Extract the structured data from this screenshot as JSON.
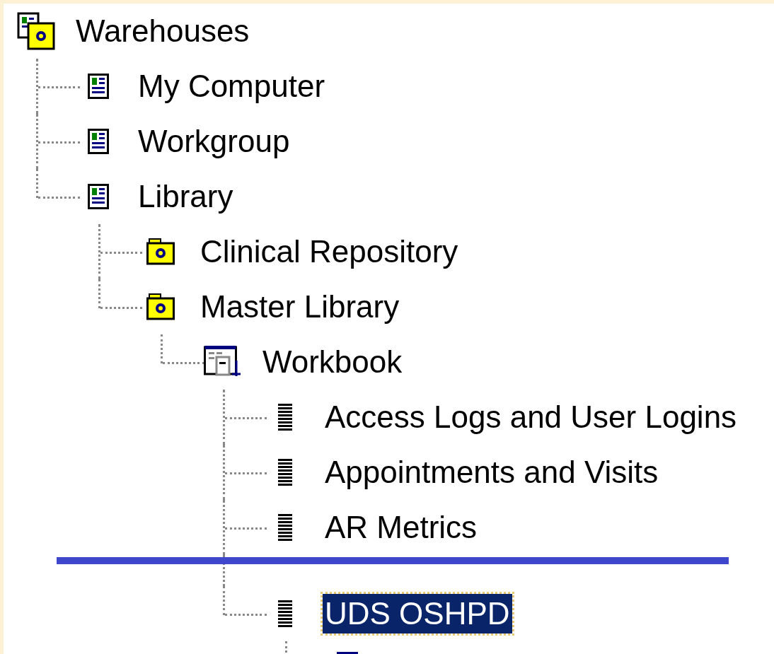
{
  "tree": [
    {
      "label": "Warehouses",
      "kind": "warehouses",
      "selected": false,
      "children": [
        {
          "label": "My Computer",
          "kind": "server",
          "selected": false
        },
        {
          "label": "Workgroup",
          "kind": "server",
          "selected": false
        },
        {
          "label": "Library",
          "kind": "server",
          "selected": false,
          "children": [
            {
              "label": "Clinical Repository",
              "kind": "folder",
              "selected": false
            },
            {
              "label": "Master Library",
              "kind": "folder",
              "selected": false,
              "children": [
                {
                  "label": "Workbook",
                  "kind": "workbook",
                  "selected": false,
                  "children": [
                    {
                      "label": "Access Logs and User Logins",
                      "kind": "report",
                      "selected": false
                    },
                    {
                      "label": "Appointments and Visits",
                      "kind": "report",
                      "selected": false
                    },
                    {
                      "label": "AR Metrics",
                      "kind": "report",
                      "selected": false
                    },
                    {
                      "kind": "drop-marker"
                    },
                    {
                      "label": "UDS OSHPD",
                      "kind": "report",
                      "selected": true,
                      "children": [
                        {
                          "kind": "query"
                        }
                      ]
                    }
                  ]
                }
              ]
            }
          ]
        }
      ]
    }
  ]
}
